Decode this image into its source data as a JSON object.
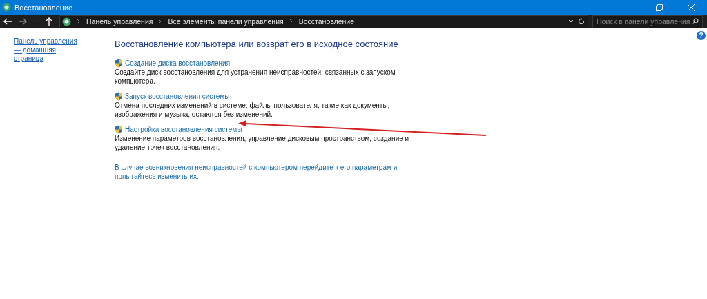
{
  "window": {
    "title": "Восстановление"
  },
  "address_bar": {
    "path": [
      "Панель управления",
      "Все элементы панели управления",
      "Восстановление"
    ]
  },
  "search": {
    "placeholder": "Поиск в панели управления"
  },
  "help": {
    "label": "?"
  },
  "sidebar": {
    "link": "Панель управления — домашняя страница"
  },
  "heading": "Восстановление компьютера или возврат его в исходное состояние",
  "items": [
    {
      "title": "Создание диска восстановления",
      "description": "Создайте диск восстановления для устранения неисправностей, связанных с запуском компьютера."
    },
    {
      "title": "Запуск восстановления системы",
      "description": "Отмена последних изменений в системе; файлы пользователя, такие как документы, изображения и музыка, остаются без изменений."
    },
    {
      "title": "Настройка восстановления системы",
      "description": "Изменение параметров восстановления, управление дисковым пространством, создание и удаление точек восстановления."
    }
  ],
  "footer_link": "В случае возникновения неисправностей с компьютером перейдите к его параметрам и попытайтесь изменить их."
}
